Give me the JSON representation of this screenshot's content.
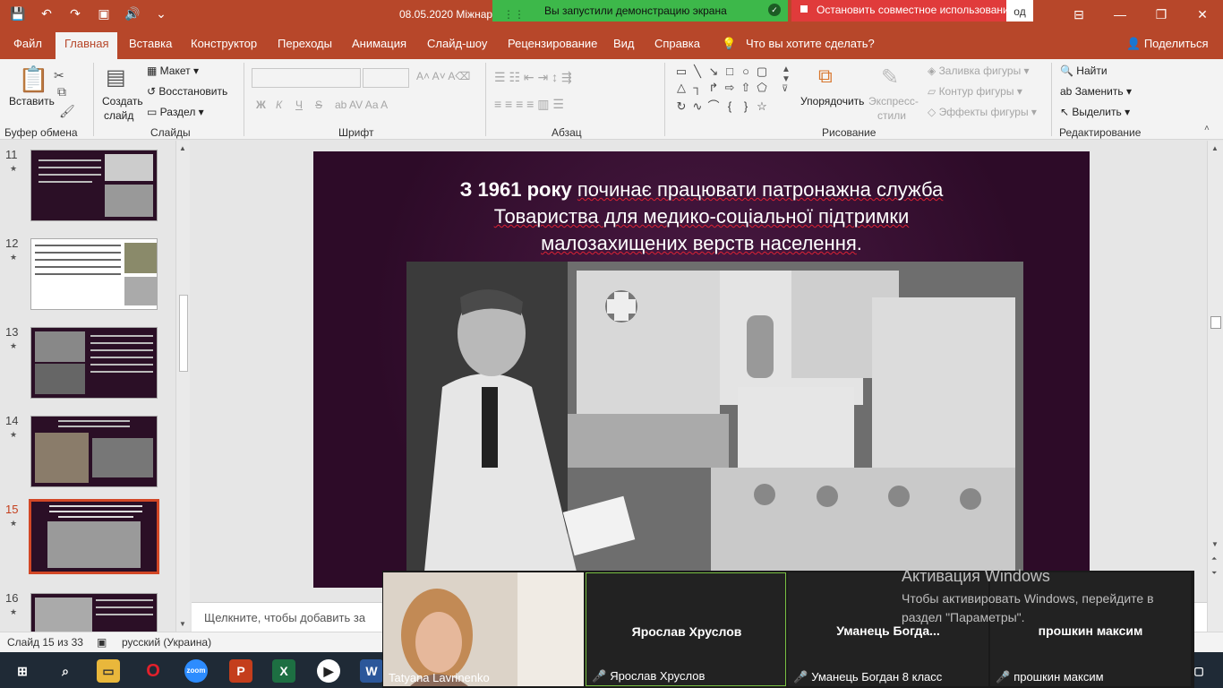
{
  "window": {
    "title": "08.05.2020 Міжнар",
    "title_tail": "од",
    "share_status": "Вы запустили демонстрацию экрана",
    "stop_share": "Остановить совместное использование"
  },
  "qat": {
    "save": "💾",
    "undo": "↶",
    "redo": "↷",
    "present": "▣",
    "audio": "🔊",
    "more": "⌄"
  },
  "tabs": [
    "Файл",
    "Главная",
    "Вставка",
    "Конструктор",
    "Переходы",
    "Анимация",
    "Слайд-шоу",
    "Рецензирование",
    "Вид",
    "Справка"
  ],
  "tell_me": "Что вы хотите сделать?",
  "share": "Поделиться",
  "ribbon": {
    "clipboard": {
      "paste": "Вставить",
      "label": "Буфер обмена"
    },
    "slides": {
      "new_slide_1": "Создать",
      "new_slide_2": "слайд",
      "layout": "Макет",
      "reset": "Восстановить",
      "section": "Раздел",
      "label": "Слайды"
    },
    "font": {
      "bold": "Ж",
      "italic": "К",
      "underline": "Ч",
      "strike": "S",
      "label": "Шрифт"
    },
    "paragraph": {
      "label": "Абзац"
    },
    "drawing": {
      "arrange": "Упорядочить",
      "quick_styles_1": "Экспресс-",
      "quick_styles_2": "стили",
      "fill": "Заливка фигуры",
      "outline": "Контур фигуры",
      "effects": "Эффекты фигуры",
      "label": "Рисование"
    },
    "editing": {
      "find": "Найти",
      "replace": "Заменить",
      "select": "Выделить",
      "label": "Редактирование"
    }
  },
  "thumbnails": [
    {
      "num": "11",
      "active": false
    },
    {
      "num": "12",
      "active": false
    },
    {
      "num": "13",
      "active": false
    },
    {
      "num": "14",
      "active": false
    },
    {
      "num": "15",
      "active": true
    },
    {
      "num": "16",
      "active": false
    }
  ],
  "slide": {
    "title_bold": "З 1961 року",
    "title_rest_1": "починає працювати патронажна служба",
    "title_line_2": "Товариства для медико-соціальної підтримки",
    "title_line_3": "малозахищених верств населення",
    "title_end": "."
  },
  "notes_placeholder": "Щелкните, чтобы добавить за",
  "status": {
    "slide_of": "Слайд 15 из 33",
    "language": "русский (Украина)"
  },
  "zoom": {
    "self_name": "Tatyana Lavrinenko",
    "participants": [
      {
        "display": "Ярослав Хруслов",
        "label": "Ярослав Хруслов"
      },
      {
        "display": "Уманець  Богда...",
        "label": "Уманець Богдан 8 класс"
      },
      {
        "display": "прошкин максим",
        "label": "прошкин максим"
      }
    ]
  },
  "activation": {
    "heading": "Активация Windows",
    "text": "Чтобы активировать Windows, перейдите в раздел \"Параметры\"."
  },
  "taskbar": [
    "start-icon",
    "search-icon",
    "file-explorer-icon",
    "opera-icon",
    "zoom-icon",
    "powerpoint-icon",
    "excel-icon",
    "media-player-icon",
    "word-icon"
  ]
}
